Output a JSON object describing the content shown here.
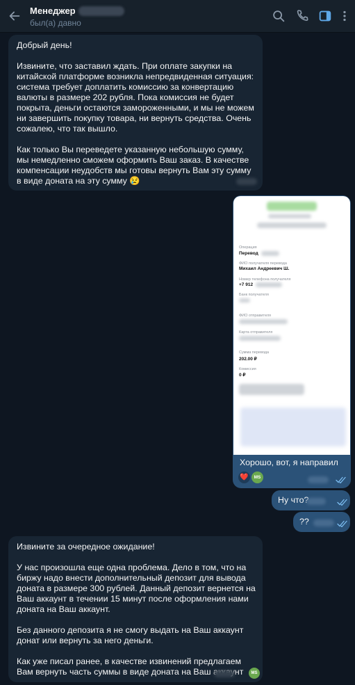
{
  "header": {
    "title": "Менеджер",
    "status": "был(а) давно"
  },
  "messages": {
    "first": {
      "greeting": "Добрый день!",
      "body1": "Извините, что заставил ждать. При оплате закупки на китайской платформе возникла непредвиденная ситуация: система требует доплатить комиссию за конвертацию валюты в размере 202 рубля. Пока комиссия не будет покрыта, деньги остаются замороженными, и мы не можем ни завершить покупку товара, ни вернуть средства. Очень сожалею, что так вышло.",
      "body2": "Как только Вы переведете указанную небольшую сумму, мы немедленно сможем оформить Ваш заказ. В качестве компенсации неудобств мы готовы вернуть Вам эту сумму в виде доната на эту сумму",
      "emoji": "😢"
    },
    "photo_caption": "Хорошо, вот, я направил",
    "reactions": {
      "heart": "❤️",
      "avatar_initials": "MS"
    },
    "out2": "Ну что?",
    "out3": "??",
    "last": {
      "line1": "Извините за очередное ожидание!",
      "body1": "У нас произошла еще одна проблема. Дело в том, что на биржу надо внести дополнительный депозит для вывода доната в размере 300 рублей. Данный депозит вернется на Ваш аккаунт в течении 15 минут после оформления нами доната на Ваш аккаунт.",
      "body2": "Без данного депозита я не смогу выдать на Ваш аккаунт донат или вернуть за него деньги.",
      "body3": "Как уже писал ранее, в качестве извинений предлагаем Вам вернуть часть суммы в виде доната на Ваш аккаунт"
    }
  },
  "receipt": {
    "op_label": "Операция",
    "op_value": "Перевод",
    "recipient_label": "ФИО получателя перевода",
    "recipient_value": "Михаил Андреевич Ш.",
    "phone_label": "Номер телефона получателя",
    "phone_value": "+7 912",
    "bank_label": "Банк получателя",
    "sender_label": "ФИО отправителя",
    "card_label": "Карта отправителя",
    "sum_label": "Сумма перевода",
    "sum_value": "202.00 ₽",
    "fee_label": "Комиссия",
    "fee_value": "0 ₽"
  },
  "colors": {
    "background": "#0e1621",
    "header": "#17212b",
    "incoming_bubble": "#182533",
    "outgoing_bubble": "#2b5278",
    "accent": "#5fa8e8"
  },
  "icons": [
    "back-arrow-icon",
    "search-icon",
    "phone-icon",
    "sidebar-panel-icon",
    "more-vertical-icon",
    "double-check-icon"
  ]
}
